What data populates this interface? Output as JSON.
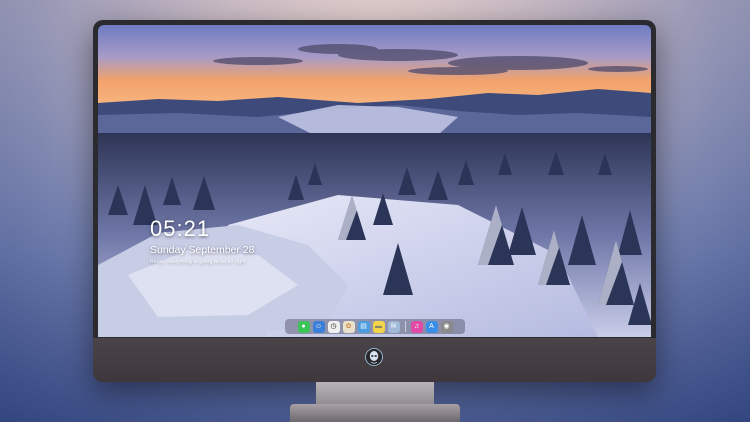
{
  "lockscreen": {
    "time": "05:21",
    "date": "Sunday September  28",
    "note": "Relax, everything is going to be all right."
  },
  "dock": {
    "icons": [
      {
        "name": "messages-icon",
        "glyph": "●",
        "color": "#3cc45a"
      },
      {
        "name": "finder-icon",
        "glyph": "☺",
        "color": "#3a7fd9"
      },
      {
        "name": "clock-icon",
        "glyph": "◷",
        "color": "#f0f0f0"
      },
      {
        "name": "photos-icon",
        "glyph": "✿",
        "color": "#e9e1c9"
      },
      {
        "name": "preview-icon",
        "glyph": "▤",
        "color": "#4a9ee0"
      },
      {
        "name": "notes-icon",
        "glyph": "▬",
        "color": "#f4d44a"
      },
      {
        "name": "mail-icon",
        "glyph": "✉",
        "color": "#9fb8d8"
      },
      {
        "name": "music-icon",
        "glyph": "♫",
        "color": "#e24aa8"
      },
      {
        "name": "app-store-icon",
        "glyph": "A",
        "color": "#3a8ee8"
      },
      {
        "name": "camera-icon",
        "glyph": "◉",
        "color": "#8a8a8a"
      }
    ]
  },
  "colors": {
    "bezel": "#2b2b2f",
    "chin": "#433d41",
    "sky_top": "#6e7bbf",
    "sky_glow": "#f2a060",
    "snow": "#d8dcf0"
  }
}
